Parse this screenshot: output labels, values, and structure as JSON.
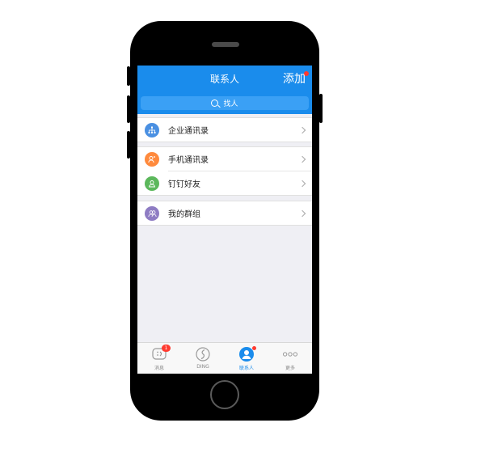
{
  "navbar": {
    "title": "联系人",
    "add_label": "添加",
    "bg_color": "#1a8cec"
  },
  "search": {
    "placeholder": "找人",
    "icon": "search-icon"
  },
  "groups": [
    [
      {
        "label": "企业通讯录",
        "icon": "org-chart-icon",
        "color": "#4a90e2"
      }
    ],
    [
      {
        "label": "手机通讯录",
        "icon": "phone-contacts-icon",
        "color": "#ff8a3d"
      },
      {
        "label": "钉钉好友",
        "icon": "friend-icon",
        "color": "#5cb85c"
      }
    ],
    [
      {
        "label": "我的群组",
        "icon": "group-icon",
        "color": "#8e7cc3"
      }
    ]
  ],
  "tabbar": {
    "tabs": [
      {
        "label": "消息",
        "icon": "message-icon",
        "badge": "1"
      },
      {
        "label": "DING",
        "icon": "ding-icon"
      },
      {
        "label": "联系人",
        "icon": "contacts-icon",
        "active": true
      },
      {
        "label": "更多",
        "icon": "more-icon"
      }
    ]
  }
}
